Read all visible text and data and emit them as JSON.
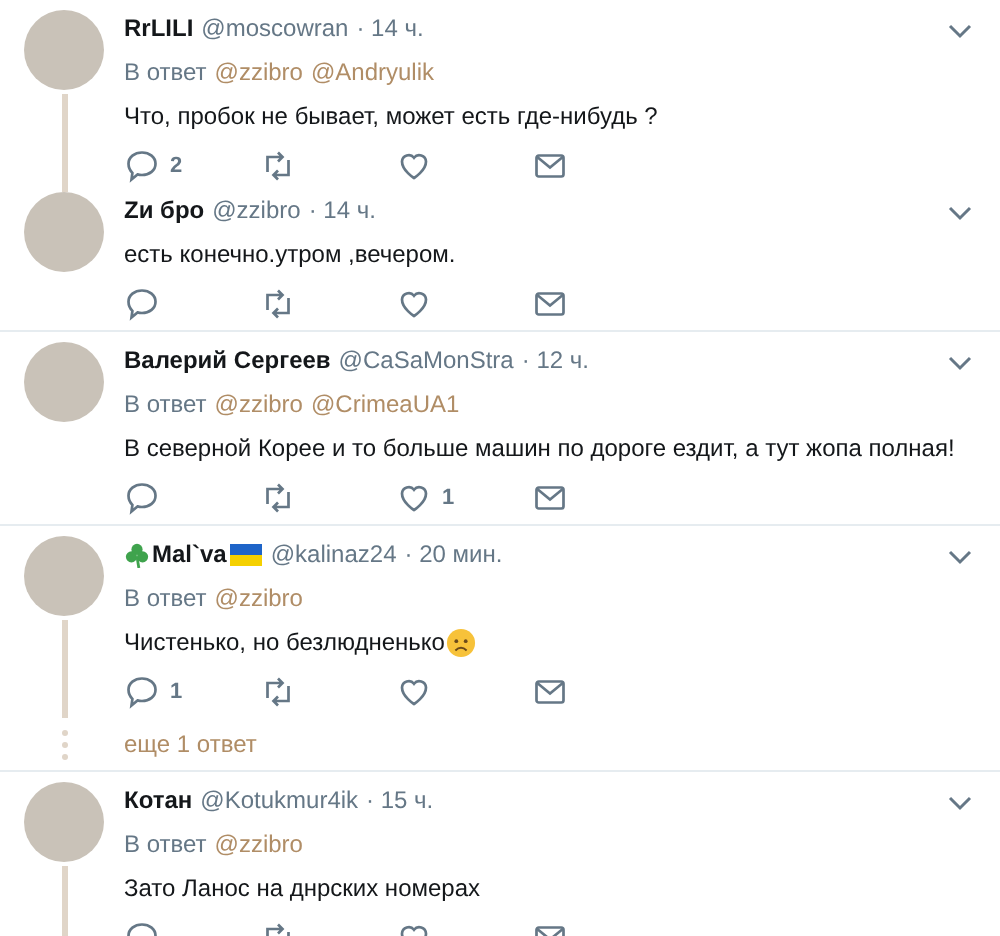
{
  "threads": [
    {
      "tweets": [
        {
          "author": {
            "name": "RrLILI",
            "kind": "plain"
          },
          "handle": "@moscowran",
          "time": "· 14 ч.",
          "reply_to": {
            "label": "В ответ",
            "mentions": [
              "@zzibro",
              "@Andryulik"
            ]
          },
          "text": "Что, пробок не бывает, может есть где-нибудь ?",
          "emoji": false,
          "replies": "2",
          "connected": true
        },
        {
          "author": {
            "name": "Zи бро",
            "kind": "plain"
          },
          "handle": "@zzibro",
          "time": "· 14 ч.",
          "text": "есть конечно.утром ,вечером.",
          "emoji": false,
          "connected": false
        }
      ]
    },
    {
      "tweets": [
        {
          "author": {
            "name": "Валерий Сергеев",
            "kind": "plain"
          },
          "handle": "@CaSaMonStra",
          "time": "· 12 ч.",
          "reply_to": {
            "label": "В ответ",
            "mentions": [
              "@zzibro",
              "@CrimeaUA1"
            ]
          },
          "text": "В северной Корее и то больше машин по дороге ездит, а тут жопа полная!",
          "emoji": false,
          "likes": "1",
          "connected": false
        }
      ]
    },
    {
      "tweets": [
        {
          "author": {
            "name": "Mal`va",
            "kind": "decorated"
          },
          "handle": "@kalinaz24",
          "time": "· 20 мин.",
          "reply_to": {
            "label": "В ответ",
            "mentions": [
              "@zzibro"
            ]
          },
          "text": "Чистенько, но безлюдненько",
          "emoji": true,
          "replies": "1",
          "connected": true
        }
      ],
      "more_replies": "еще 1 ответ"
    },
    {
      "tweets": [
        {
          "author": {
            "name": "Котан",
            "kind": "plain"
          },
          "handle": "@Kotukmur4ik",
          "time": "· 15 ч.",
          "reply_to": {
            "label": "В ответ",
            "mentions": [
              "@zzibro"
            ]
          },
          "text": "Зато Ланос на днрских номерах",
          "emoji": false,
          "connected": true
        }
      ]
    }
  ]
}
